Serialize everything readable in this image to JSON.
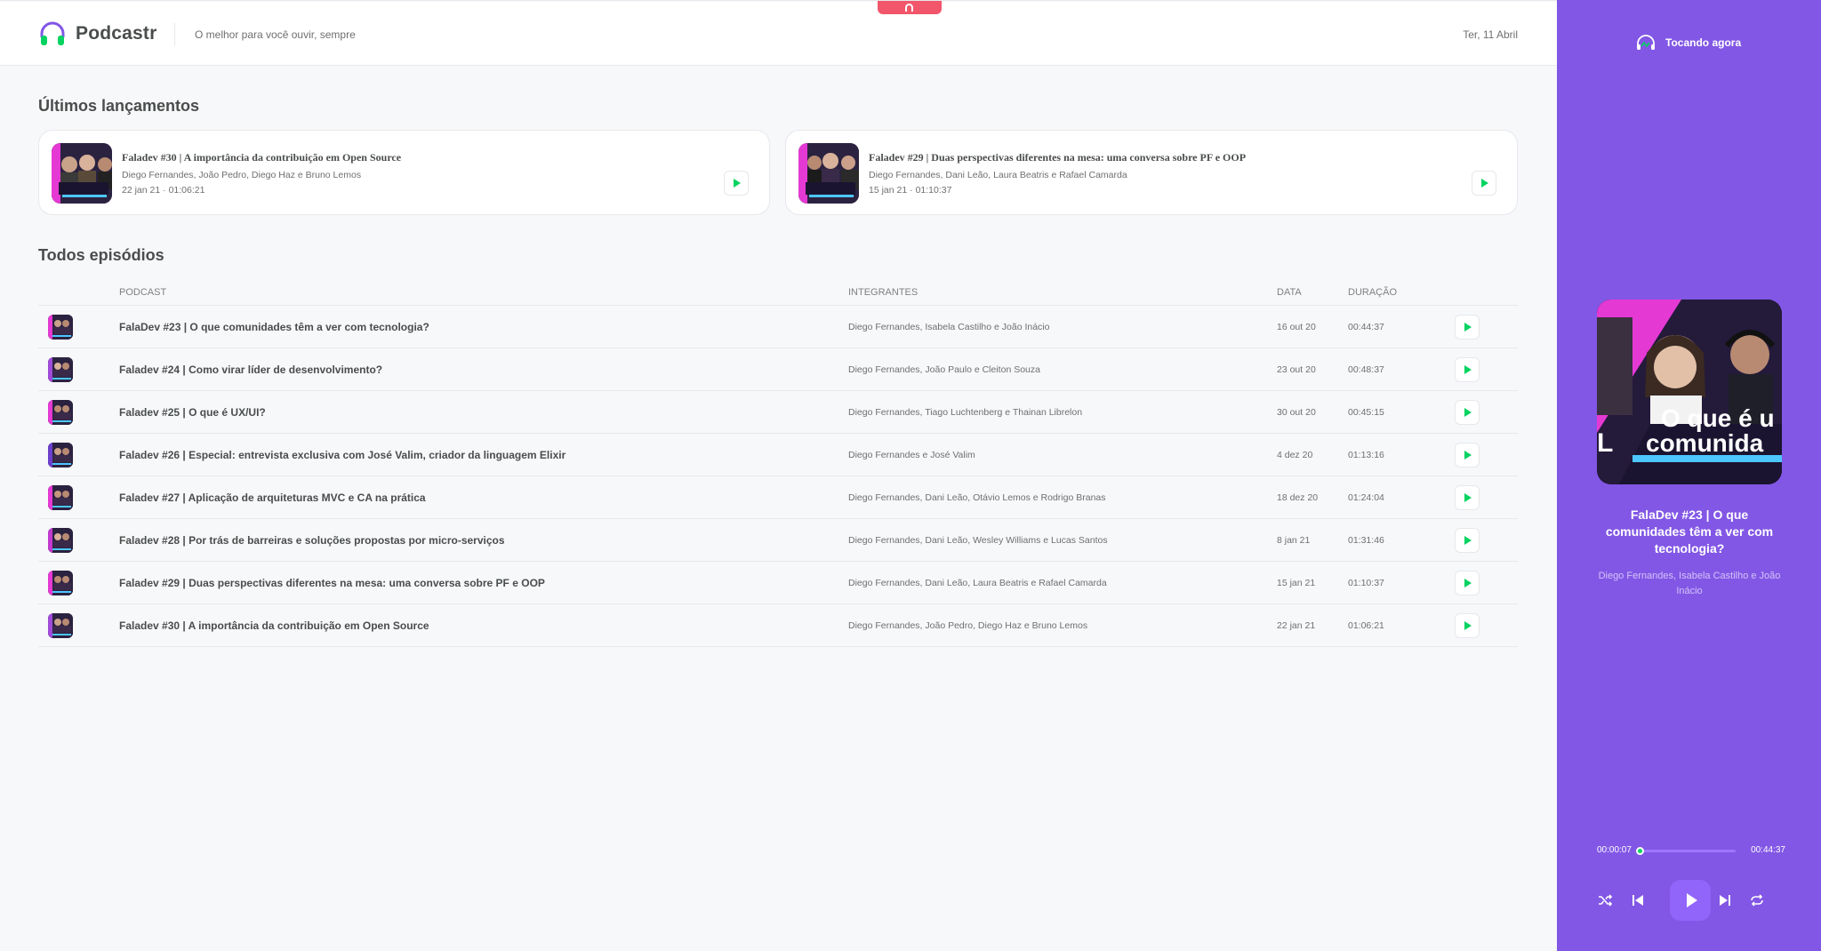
{
  "app": {
    "name": "Podcastr",
    "tagline": "O melhor para você ouvir, sempre",
    "date": "Ter, 11 Abril"
  },
  "colors": {
    "brand": "#8257e5",
    "play_green": "#04d361",
    "top_tab": "#f1566b"
  },
  "latest": {
    "title": "Últimos lançamentos",
    "items": [
      {
        "title": "Faladev #30 | A importância da contribuição em Open Source",
        "members": "Diego Fernandes, João Pedro, Diego Haz e Bruno Lemos",
        "date": "22 jan 21",
        "duration": "01:06:21"
      },
      {
        "title": "Faladev #29 | Duas perspectivas diferentes na mesa: uma conversa sobre PF e OOP",
        "members": "Diego Fernandes, Dani Leão, Laura Beatris e Rafael Camarda",
        "date": "15 jan 21",
        "duration": "01:10:37"
      }
    ]
  },
  "all": {
    "title": "Todos episódios",
    "headers": {
      "podcast": "Podcast",
      "members": "Integrantes",
      "date": "Data",
      "duration": "Duração"
    },
    "rows": [
      {
        "title": "FalaDev #23 | O que comunidades têm a ver com tecnologia?",
        "members": "Diego Fernandes, Isabela Castilho e João Inácio",
        "date": "16 out 20",
        "duration": "00:44:37"
      },
      {
        "title": "Faladev #24 | Como virar líder de desenvolvimento?",
        "members": "Diego Fernandes, João Paulo e Cleiton Souza",
        "date": "23 out 20",
        "duration": "00:48:37"
      },
      {
        "title": "Faladev #25 | O que é UX/UI?",
        "members": "Diego Fernandes, Tiago Luchtenberg e Thainan Librelon",
        "date": "30 out 20",
        "duration": "00:45:15"
      },
      {
        "title": "Faladev #26 | Especial: entrevista exclusiva com José Valim, criador da linguagem Elixir",
        "members": "Diego Fernandes e José Valim",
        "date": "4 dez 20",
        "duration": "01:13:16"
      },
      {
        "title": "Faladev #27 | Aplicação de arquiteturas MVC e CA na prática",
        "members": "Diego Fernandes, Dani Leão, Otávio Lemos e Rodrigo Branas",
        "date": "18 dez 20",
        "duration": "01:24:04"
      },
      {
        "title": "Faladev #28 | Por trás de barreiras e soluções propostas por micro-serviços",
        "members": "Diego Fernandes, Dani Leão, Wesley Williams e Lucas Santos",
        "date": "8 jan 21",
        "duration": "01:31:46"
      },
      {
        "title": "Faladev #29 | Duas perspectivas diferentes na mesa: uma conversa sobre PF e OOP",
        "members": "Diego Fernandes, Dani Leão, Laura Beatris e Rafael Camarda",
        "date": "15 jan 21",
        "duration": "01:10:37"
      },
      {
        "title": "Faladev #30 | A importância da contribuição em Open Source",
        "members": "Diego Fernandes, João Pedro, Diego Haz e Bruno Lemos",
        "date": "22 jan 21",
        "duration": "01:06:21"
      }
    ]
  },
  "player": {
    "label": "Tocando agora",
    "title": "FalaDev #23 | O que comunidades têm a ver com tecnologia?",
    "members": "Diego Fernandes, Isabela Castilho e João Inácio",
    "cover_text_line1": "O que é u",
    "cover_text_line2": "comunida",
    "cover_letter": "L",
    "elapsed": "00:00:07",
    "total": "00:44:37",
    "progress_fraction": 0.003,
    "icons": [
      "shuffle-icon",
      "previous-icon",
      "play-icon",
      "next-icon",
      "repeat-icon"
    ]
  }
}
